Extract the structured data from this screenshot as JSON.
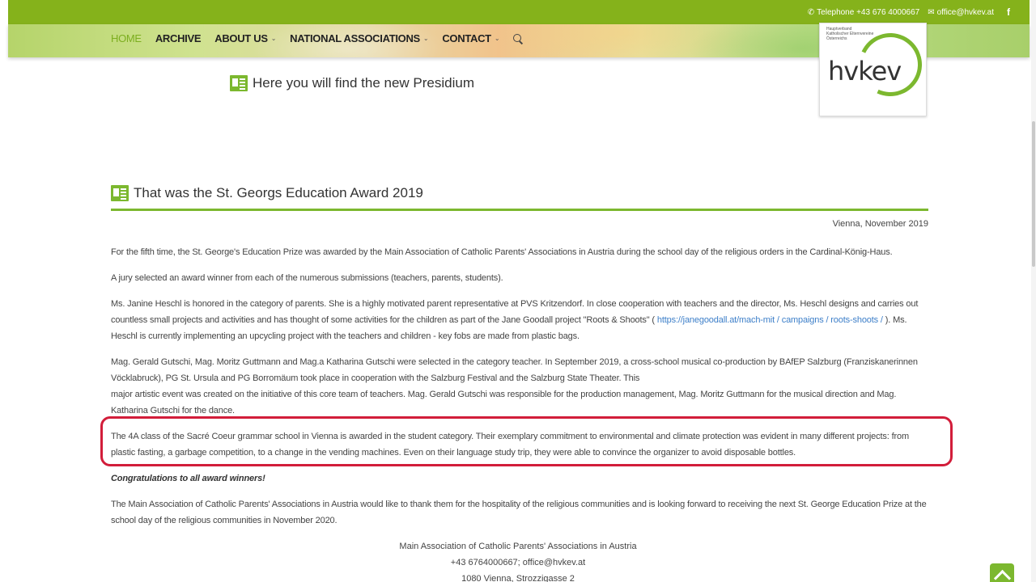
{
  "topbar": {
    "phone": "Telephone +43 676 4000667",
    "email": "office@hvkev.at",
    "facebook": "f"
  },
  "nav": {
    "items": [
      {
        "label": "HOME",
        "active": true,
        "dropdown": false
      },
      {
        "label": "ARCHIVE",
        "active": false,
        "dropdown": false
      },
      {
        "label": "ABOUT US",
        "active": false,
        "dropdown": true
      },
      {
        "label": "NATIONAL ASSOCIATIONS",
        "active": false,
        "dropdown": true
      },
      {
        "label": "CONTACT",
        "active": false,
        "dropdown": true
      }
    ],
    "search_icon": "search-icon"
  },
  "logo": {
    "tagline": "Hauptverband Katholischer Elternvereine Österreichs",
    "wordmark": "hvkev"
  },
  "presidium": {
    "text": "Here you will find the new Presidium"
  },
  "article": {
    "heading": "That was the St. Georgs Education Award 2019",
    "date": "Vienna, November 2019",
    "p1": "For the fifth time, the St. George's Education Prize was awarded by the Main Association of Catholic Parents' Associations in Austria during the school day of the religious orders in the Cardinal-König-Haus.",
    "p2": "A jury selected an award winner from each of the numerous submissions (teachers, parents, students).",
    "p3_start": "Ms. Janine Heschl is honored in the category of parents. She is a highly motivated parent representative at PVS Kritzendorf. In close cooperation with teachers and the director, Ms. Heschl designs and carries out countless small projects and activities and has thought of some activities for the children as part of the Jane Goodall project \"Roots & Shoots\" ( ",
    "p3_link": "https://janegoodall.at/mach-mit / campaigns / roots-shoots /",
    "p3_end": " ). Ms. Heschl is currently implementing an upcycling project with the teachers and children - key fobs are made from plastic bags.",
    "p4_a": "Mag. Gerald Gutschi, Mag. Moritz Guttmann and Mag.a Katharina Gutschi were selected in the category teacher. In September 2019, a cross-school musical co-production by BAfEP Salzburg (Franziskanerinnen Vöcklabruck), PG St. Ursula and PG Borromäum took place in cooperation with the Salzburg Festival and the Salzburg State Theater. This",
    "p4_b": "major artistic event was created on the initiative of this core team of teachers. Mag. Gerald Gutschi was responsible for the production management, Mag. Moritz Guttmann for the musical direction and Mag. Katharina Gutschi for the dance.",
    "p5": "The 4A class of the Sacré Coeur grammar school in Vienna is awarded in the student category. Their exemplary commitment to environmental and climate protection was evident in many different projects: from plastic fasting, a garbage competition, to a change in the vending machines. Even on their language study trip, they were able to convince the organizer to avoid disposable bottles.",
    "congrats": "Congratulations to all award winners!",
    "p6": "The Main Association of Catholic Parents' Associations in Austria would like to thank them for the hospitality of the religious communities and is looking forward to receiving the next St. George Education Prize at the school day of the religious communities in November 2020."
  },
  "footer": {
    "line1": "Main Association of Catholic Parents' Associations in Austria",
    "line2": "+43 6764000667; office@hvkev.at",
    "line3": "1080 Vienna, Strozzigasse 2"
  },
  "colors": {
    "brand_green": "#85b21b",
    "highlight_red": "#d21d3a",
    "link_blue": "#3d7fc9"
  }
}
